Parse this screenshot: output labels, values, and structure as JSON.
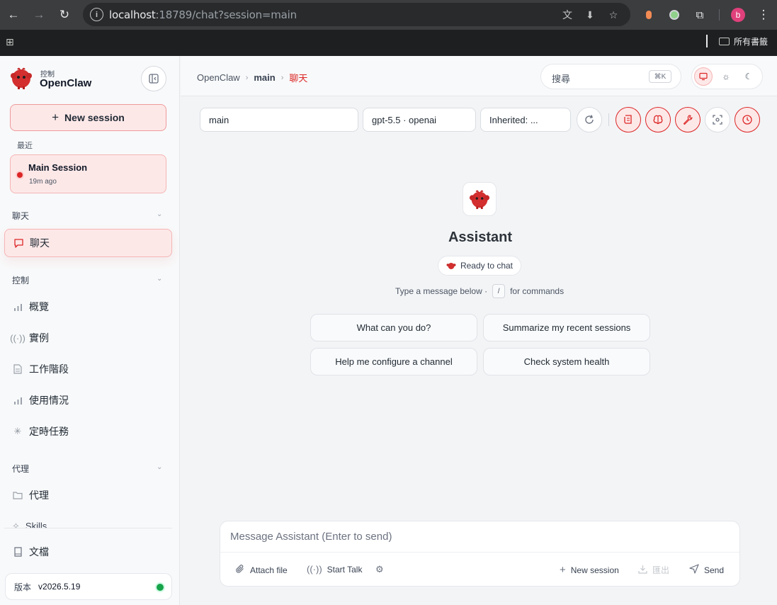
{
  "browser": {
    "url_host": "localhost",
    "url_rest": ":18789/chat?session=main",
    "bookmarks_label": "所有書籤",
    "profile_initial": "b"
  },
  "sidebar": {
    "brand_sub": "控制",
    "brand_title": "OpenClaw",
    "new_session_label": "New session",
    "recent_label": "最近",
    "recent_session": {
      "title": "Main Session",
      "time": "19m ago"
    },
    "groups": [
      {
        "label": "聊天",
        "items": [
          {
            "label": "聊天",
            "icon": "chat-bubble-icon",
            "active": true
          }
        ]
      },
      {
        "label": "控制",
        "items": [
          {
            "label": "概覽",
            "icon": "bar-chart-icon"
          },
          {
            "label": "實例",
            "icon": "radio-icon"
          },
          {
            "label": "工作階段",
            "icon": "document-icon"
          },
          {
            "label": "使用情況",
            "icon": "bar-chart-icon"
          },
          {
            "label": "定時任務",
            "icon": "loader-icon"
          }
        ]
      },
      {
        "label": "代理",
        "items": [
          {
            "label": "代理",
            "icon": "folder-icon"
          },
          {
            "label": "Skills",
            "icon": "sparkle-icon"
          }
        ]
      }
    ],
    "docs_label": "文檔",
    "version_label": "版本",
    "version_value": "v2026.5.19",
    "status_color": "#16a34a"
  },
  "main": {
    "breadcrumb": [
      "OpenClaw",
      "main",
      "聊天"
    ],
    "search_placeholder": "搜尋",
    "search_shortcut": "⌘K",
    "controls": {
      "session": "main",
      "model": "gpt-5.5 · openai",
      "thinking": "Inherited: ..."
    },
    "assistant_name": "Assistant",
    "ready_label": "Ready to chat",
    "hint_before": "Type a message below ·",
    "hint_key": "/",
    "hint_after": "for commands",
    "suggestions": [
      "What can you do?",
      "Summarize my recent sessions",
      "Help me configure a channel",
      "Check system health"
    ],
    "composer": {
      "placeholder": "Message Assistant (Enter to send)",
      "attach_label": "Attach file",
      "talk_label": "Start Talk",
      "new_session_label": "New session",
      "export_label": "匯出",
      "send_label": "Send"
    }
  },
  "colors": {
    "accent": "#dc2626",
    "accent_bg": "#fde8e8",
    "status_ok": "#16a34a"
  }
}
